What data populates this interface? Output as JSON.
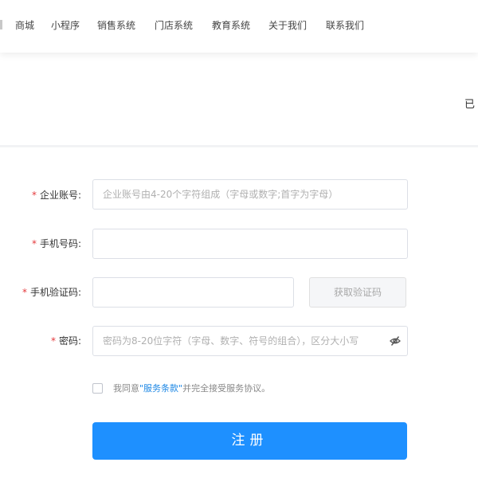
{
  "nav": {
    "items": [
      "商城",
      "小程序",
      "销售系统",
      "门店系统",
      "教育系统",
      "关于我们",
      "联系我们"
    ]
  },
  "header": {
    "right_text": "已"
  },
  "form": {
    "required_mark": "*",
    "company_account": {
      "label": "企业账号:",
      "placeholder": "企业账号由4-20个字符组成（字母或数字;首字为字母）"
    },
    "phone": {
      "label": "手机号码:",
      "placeholder": ""
    },
    "sms_code": {
      "label": "手机验证码:",
      "placeholder": "",
      "button": "获取验证码"
    },
    "password": {
      "label": "密码:",
      "placeholder": "密码为8-20位字符（字母、数字、符号的组合），区分大小写",
      "toggle_icon": "eye-off-icon"
    },
    "agreement": {
      "checked": false,
      "prefix": "我同意",
      "link": "\"服务条款\"",
      "suffix": "并完全接受服务协议。"
    },
    "submit": "注册"
  },
  "colors": {
    "accent": "#1e90ff",
    "required": "#e4393c",
    "link": "#1e88e5"
  }
}
